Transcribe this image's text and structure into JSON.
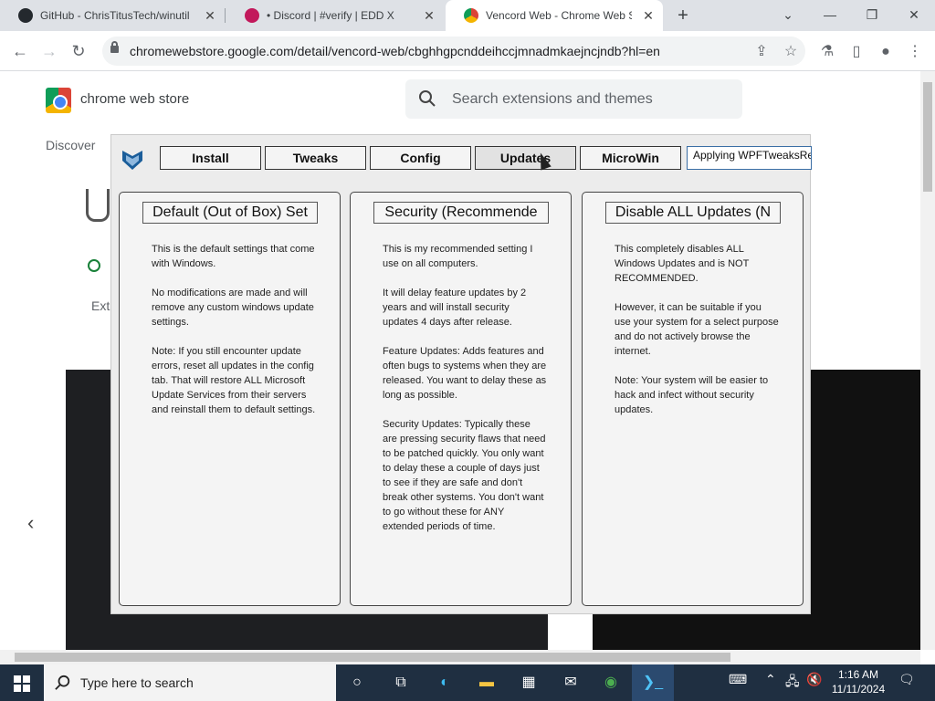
{
  "browser": {
    "tabs": [
      {
        "title": "GitHub - ChrisTitusTech/winutil",
        "active": false
      },
      {
        "title": "• Discord | #verify | EDD X",
        "active": false
      },
      {
        "title": "Vencord Web - Chrome Web Store",
        "active": true
      }
    ],
    "url": "chromewebstore.google.com/detail/vencord-web/cbghhgpcnddeihccjmnadmkaejncjndb?hl=en"
  },
  "store": {
    "title": "chrome web store",
    "search_placeholder": "Search extensions and themes",
    "discover": "Discover",
    "ext_partial": "Ext"
  },
  "winutil": {
    "nav": [
      "Install",
      "Tweaks",
      "Config",
      "Updates",
      "MicroWin"
    ],
    "selected_nav": "Updates",
    "status": "Applying WPFTweaksRe",
    "cards": [
      {
        "button": "Default (Out of Box) Set",
        "description": "This is the default settings that come with Windows.\n\nNo modifications are made and will remove any custom windows update settings.\n\nNote: If you still encounter update errors, reset all updates in the config tab. That will restore ALL Microsoft Update Services from their servers and reinstall them to default settings."
      },
      {
        "button": "Security (Recommende",
        "description": "This is my recommended setting I use on all computers.\n\nIt will delay feature updates by 2 years and will install security updates 4 days after release.\n\nFeature Updates: Adds features and often bugs to systems when they are released. You want to delay these as long as possible.\n\nSecurity Updates: Typically these are pressing security flaws that need to be patched quickly. You only want to delay these a couple of days just to see if they are safe and don't break other systems. You don't want to go without these for ANY extended periods of time."
      },
      {
        "button": "Disable ALL Updates (N",
        "description": "This completely disables ALL Windows Updates and is NOT RECOMMENDED.\n\nHowever, it can be suitable if you use your system for a select purpose and do not actively browse the internet.\n\nNote: Your system will be easier to hack and infect without security updates."
      }
    ]
  },
  "taskbar": {
    "search_placeholder": "Type here to search",
    "time": "1:16 AM",
    "date": "11/11/2024"
  },
  "colors": {
    "taskbar": "#1f2f41",
    "chrome_tabbar": "#dee1e6",
    "winutil_bg": "#ececec"
  }
}
